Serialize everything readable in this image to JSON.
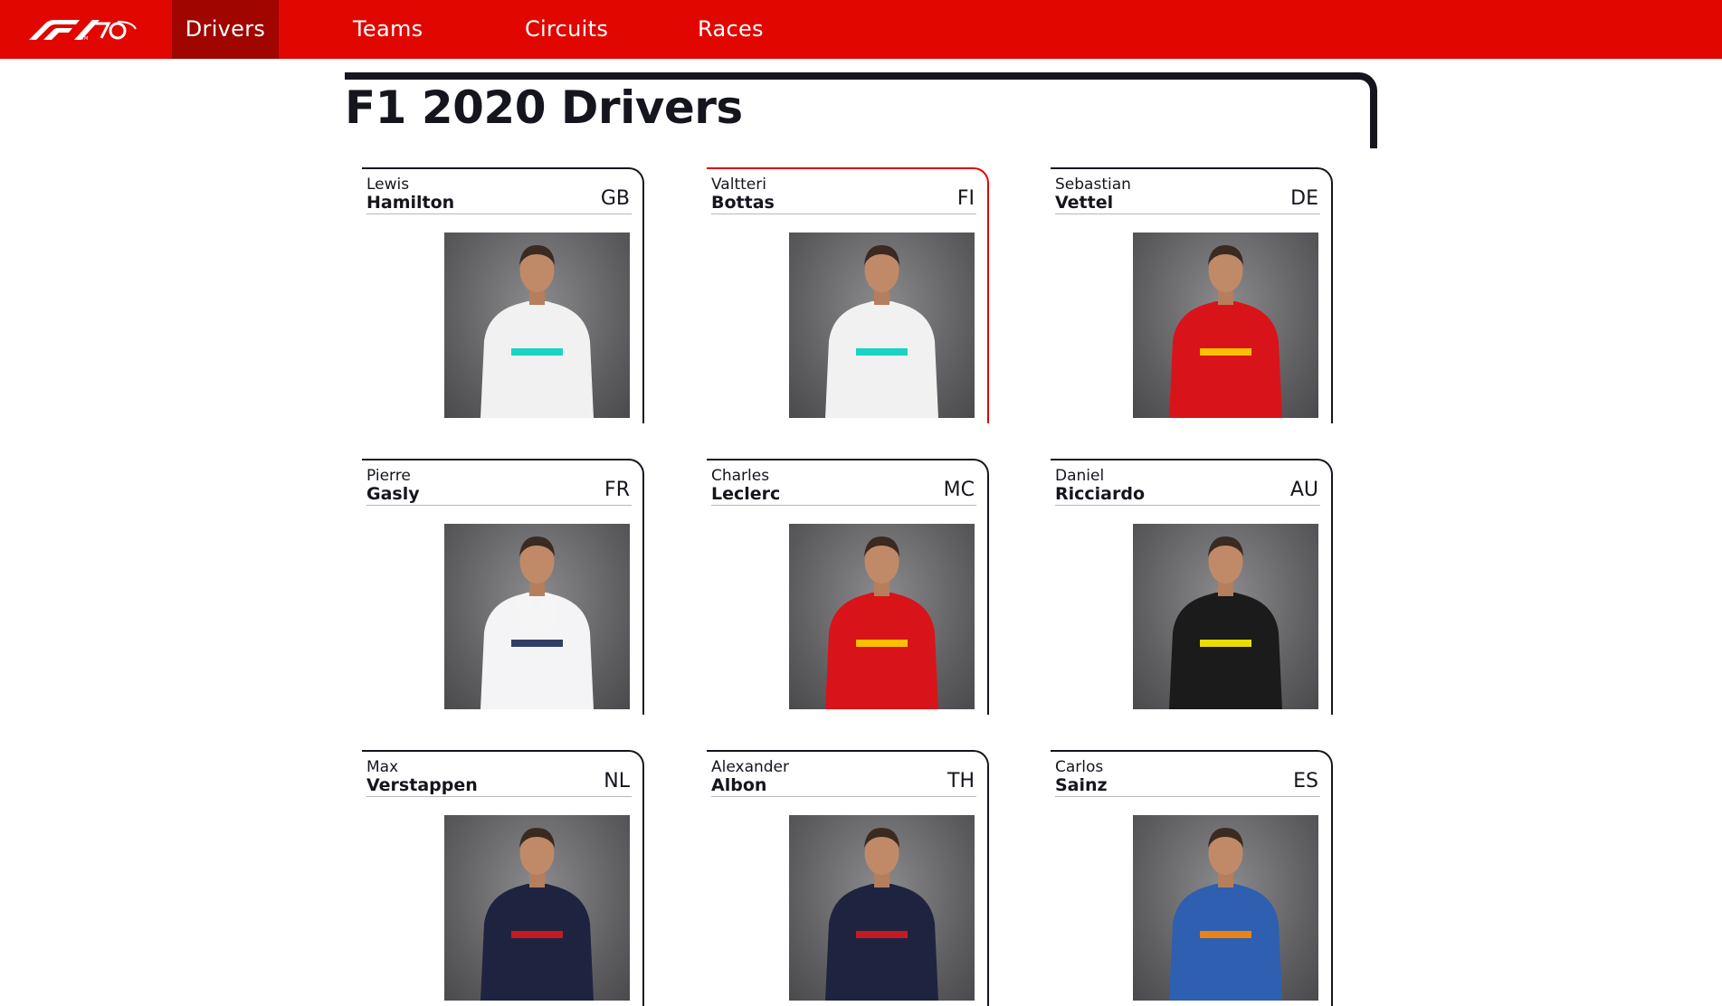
{
  "nav": {
    "logo_icon": "f1-70-logo-icon",
    "items": [
      {
        "label": "Drivers",
        "active": true
      },
      {
        "label": "Teams",
        "active": false
      },
      {
        "label": "Circuits",
        "active": false
      },
      {
        "label": "Races",
        "active": false
      }
    ]
  },
  "colors": {
    "nav_red": "#e10600",
    "nav_active": "#a00500",
    "text": "#15151e"
  },
  "page": {
    "title": "F1 2020 Drivers"
  },
  "drivers": [
    {
      "first": "Lewis",
      "last": "Hamilton",
      "code": "GB",
      "suit": "#f1f1f1",
      "accent": "#00d2be"
    },
    {
      "first": "Valtteri",
      "last": "Bottas",
      "code": "FI",
      "suit": "#f1f1f1",
      "accent": "#00d2be"
    },
    {
      "first": "Sebastian",
      "last": "Vettel",
      "code": "DE",
      "suit": "#d8141a",
      "accent": "#ffd200"
    },
    {
      "first": "Pierre",
      "last": "Gasly",
      "code": "FR",
      "suit": "#f4f4f6",
      "accent": "#1c2a55"
    },
    {
      "first": "Charles",
      "last": "Leclerc",
      "code": "MC",
      "suit": "#d8141a",
      "accent": "#ffd200"
    },
    {
      "first": "Daniel",
      "last": "Ricciardo",
      "code": "AU",
      "suit": "#1b1b1b",
      "accent": "#fff200"
    },
    {
      "first": "Max",
      "last": "Verstappen",
      "code": "NL",
      "suit": "#1e2440",
      "accent": "#d71921"
    },
    {
      "first": "Alexander",
      "last": "Albon",
      "code": "TH",
      "suit": "#1e2440",
      "accent": "#d71921"
    },
    {
      "first": "Carlos",
      "last": "Sainz",
      "code": "ES",
      "suit": "#2f5fb0",
      "accent": "#ff8700"
    }
  ]
}
